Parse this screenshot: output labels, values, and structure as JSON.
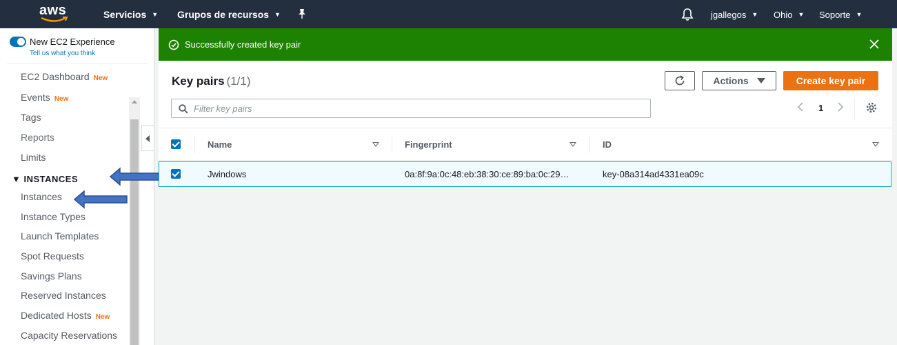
{
  "topnav": {
    "logo": "aws",
    "services": "Servicios",
    "resource_groups": "Grupos de recursos",
    "pin_icon": "pin-icon",
    "bell_icon": "bell-icon",
    "user": "jgallegos",
    "region": "Ohio",
    "support": "Soporte"
  },
  "sidebar": {
    "experience_title": "New EC2 Experience",
    "experience_link": "Tell us what you think",
    "new_badge": "New",
    "items": [
      {
        "label": "EC2 Dashboard",
        "badge": "New"
      },
      {
        "label": "Events",
        "badge": "New"
      },
      {
        "label": "Tags"
      },
      {
        "label": "Reports"
      },
      {
        "label": "Limits"
      }
    ],
    "section": "INSTANCES",
    "section_items": [
      {
        "label": "Instances"
      },
      {
        "label": "Instance Types"
      },
      {
        "label": "Launch Templates"
      },
      {
        "label": "Spot Requests"
      },
      {
        "label": "Savings Plans"
      },
      {
        "label": "Reserved Instances"
      },
      {
        "label": "Dedicated Hosts",
        "badge": "New"
      },
      {
        "label": "Capacity Reservations"
      }
    ]
  },
  "flash": {
    "message": "Successfully created key pair",
    "color": "#1d8102"
  },
  "panel": {
    "title": "Key pairs",
    "count": "(1/1)",
    "actions_label": "Actions",
    "create_label": "Create key pair",
    "search_placeholder": "Filter key pairs",
    "page": "1"
  },
  "table": {
    "columns": [
      "Name",
      "Fingerprint",
      "ID"
    ],
    "rows": [
      {
        "name": "Jwindows",
        "fingerprint": "0a:8f:9a:0c:48:eb:38:30:ce:89:ba:0c:29…",
        "id": "key-08a314ad4331ea09c",
        "selected": true
      }
    ]
  },
  "colors": {
    "nav": "#232f3e",
    "accent": "#ec7211",
    "link": "#0073bb",
    "success": "#1d8102",
    "annotation_arrow": "#4472c4"
  }
}
